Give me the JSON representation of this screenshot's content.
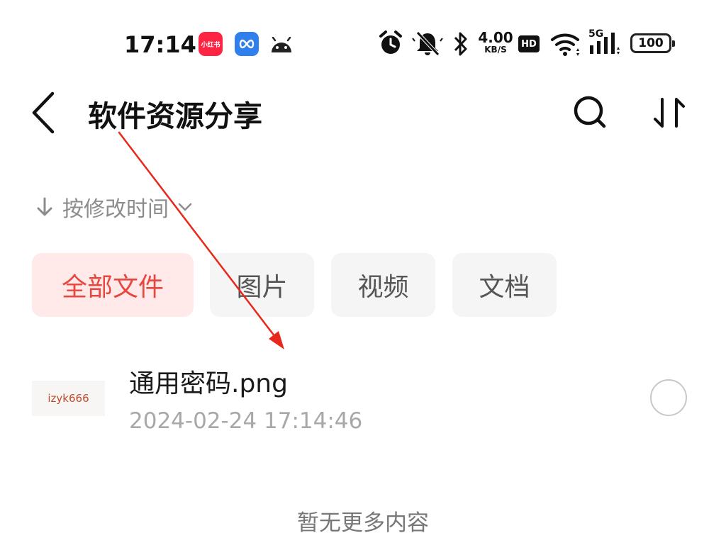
{
  "status_bar": {
    "time": "17:14",
    "app_icons": [
      {
        "name": "xiaohongshu-app-icon",
        "label": "小红书",
        "color": "#ff2442"
      },
      {
        "name": "infinity-app-icon",
        "color": "#2f80ed"
      },
      {
        "name": "android-icon"
      }
    ],
    "network_speed_value": "4.00",
    "network_speed_unit": "KB/S",
    "hd_label": "HD",
    "network_type": "5G",
    "battery_level": "100",
    "icons": [
      "alarm-clock-icon",
      "muted-bell-icon",
      "bluetooth-icon",
      "wifi-icon",
      "cellular-signal-icon",
      "battery-icon"
    ]
  },
  "header": {
    "title": "软件资源分享",
    "back_icon": "back-chevron-icon",
    "actions": [
      "search-icon",
      "sort-arrows-icon"
    ]
  },
  "sort": {
    "label": "按修改时间",
    "direction_icon": "arrow-down-icon",
    "dropdown_icon": "chevron-down-icon"
  },
  "filters": {
    "chips": [
      {
        "label": "全部文件",
        "active": true
      },
      {
        "label": "图片",
        "active": false
      },
      {
        "label": "视频",
        "active": false
      },
      {
        "label": "文档",
        "active": false
      }
    ]
  },
  "files": [
    {
      "thumbnail_text": "izyk666",
      "name": "通用密码.png",
      "modified": "2024-02-24 17:14:46",
      "selected": false
    }
  ],
  "footer": {
    "text": "暂无更多内容"
  },
  "colors": {
    "accent": "#e8473f",
    "active_chip_bg": "#ffe9e9",
    "chip_bg": "#f5f5f5",
    "annotation_arrow": "#e8281c"
  }
}
